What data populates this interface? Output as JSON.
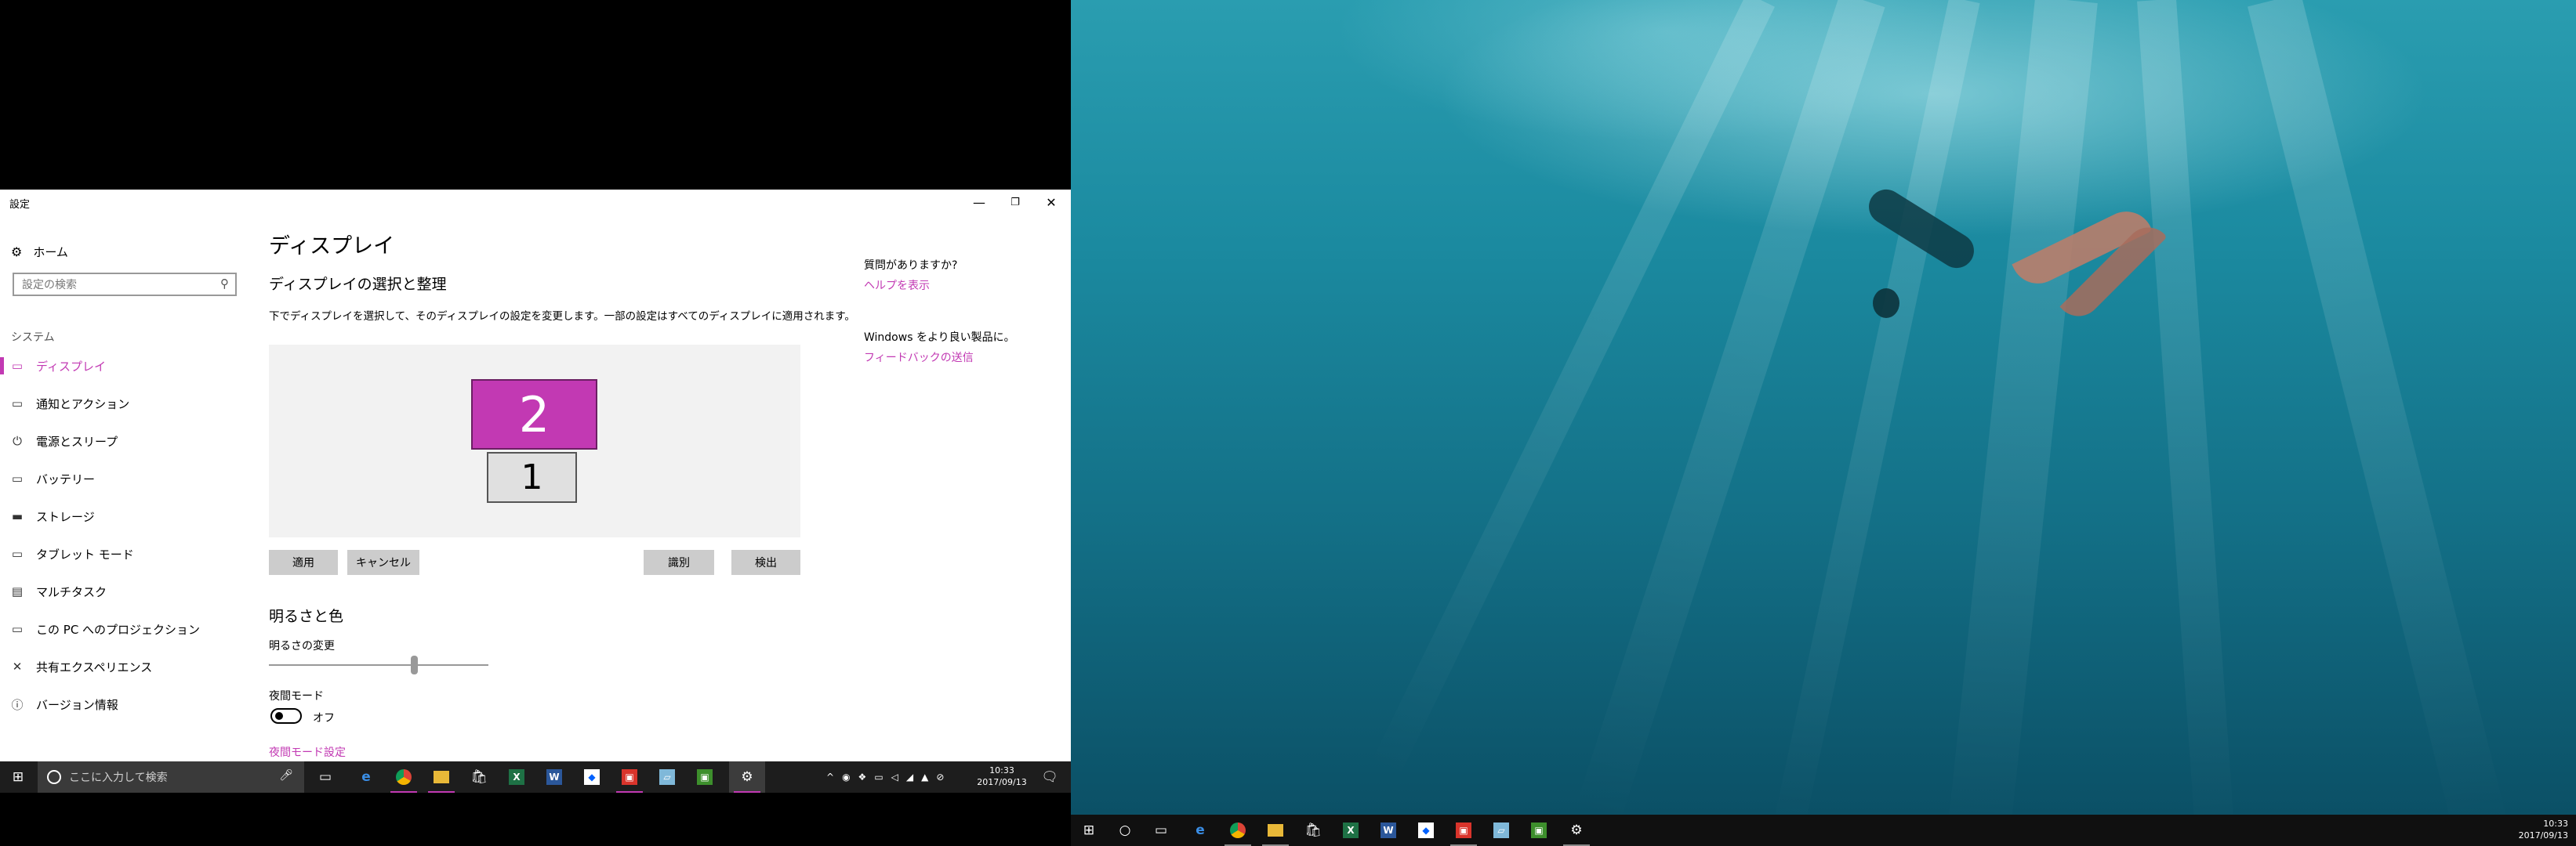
{
  "window": {
    "title": "設定",
    "minimize_icon": "minimize-icon",
    "maximize_icon": "restore-icon",
    "close_icon": "close-icon"
  },
  "sidebar": {
    "home_label": "ホーム",
    "search_placeholder": "設定の検索",
    "section_label": "システム",
    "items": [
      {
        "label": "ディスプレイ",
        "icon": "monitor-icon",
        "active": true
      },
      {
        "label": "通知とアクション",
        "icon": "notification-icon"
      },
      {
        "label": "電源とスリープ",
        "icon": "power-icon"
      },
      {
        "label": "バッテリー",
        "icon": "battery-icon"
      },
      {
        "label": "ストレージ",
        "icon": "storage-icon"
      },
      {
        "label": "タブレット モード",
        "icon": "tablet-icon"
      },
      {
        "label": "マルチタスク",
        "icon": "multitask-icon"
      },
      {
        "label": "この PC へのプロジェクション",
        "icon": "projection-icon"
      },
      {
        "label": "共有エクスペリエンス",
        "icon": "shared-icon"
      },
      {
        "label": "バージョン情報",
        "icon": "info-icon"
      }
    ]
  },
  "main": {
    "title": "ディスプレイ",
    "subtitle": "ディスプレイの選択と整理",
    "description": "下でディスプレイを選択して、そのディスプレイの設定を変更します。一部の設定はすべてのディスプレイに適用されます。",
    "monitor_selected": "2",
    "monitor_other": "1",
    "buttons": {
      "apply": "適用",
      "cancel": "キャンセル",
      "identify": "識別",
      "detect": "検出"
    },
    "brightness_section": "明るさと色",
    "brightness_label": "明るさの変更",
    "brightness_value": 0.66,
    "night_mode_label": "夜間モード",
    "night_mode_state": "オフ",
    "night_mode_link": "夜間モード設定"
  },
  "aside": {
    "question": "質問がありますか?",
    "help_link": "ヘルプを表示",
    "feedback_question": "Windows をより良い製品に。",
    "feedback_link": "フィードバックの送信"
  },
  "taskbar1": {
    "search_placeholder": "ここに入力して検索",
    "time": "10:33",
    "date": "2017/09/13"
  },
  "taskbar2": {
    "time": "10:33",
    "date": "2017/09/13"
  },
  "colors": {
    "accent": "#c239b3",
    "taskbar": "#1d1d1d"
  }
}
